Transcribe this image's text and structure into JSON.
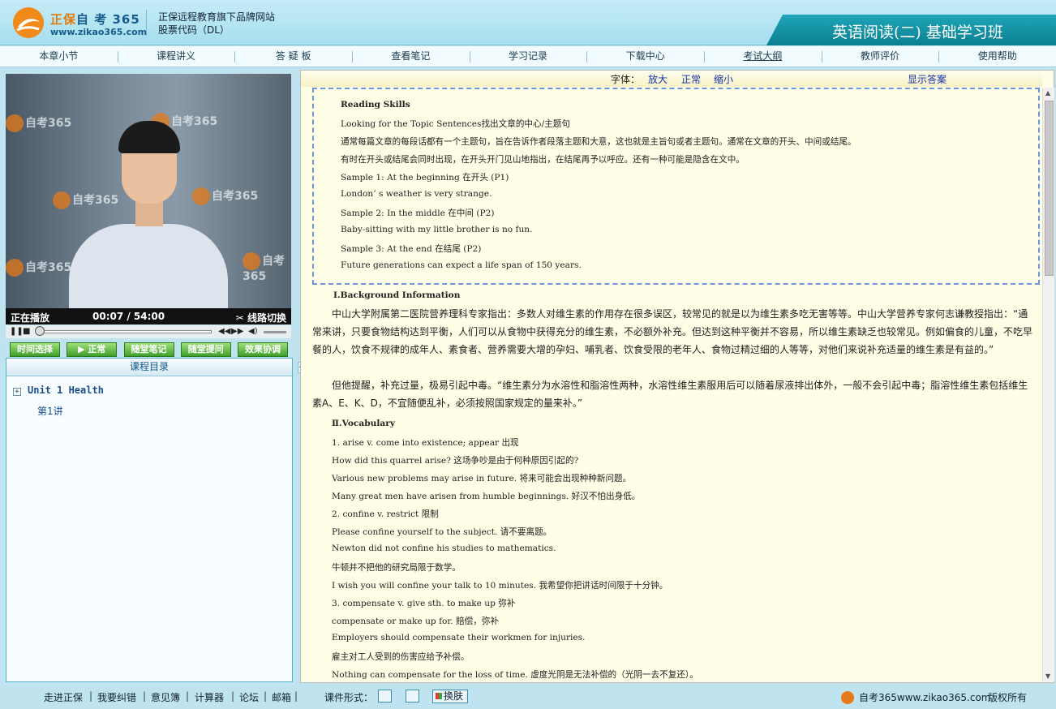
{
  "header": {
    "brand_cn": "正保",
    "brand_cn2": "自 考 365",
    "brand_url": "www.zikao365.com",
    "tagline1": "正保远程教育旗下品牌网站",
    "tagline2": "股票代码（DL）",
    "course_title": "英语阅读(二) 基础学习班"
  },
  "nav": [
    "本章小节",
    "课程讲义",
    "答 疑 板",
    "查看笔记",
    "学习记录",
    "下载中心",
    "考试大纲",
    "教师评价",
    "使用帮助"
  ],
  "player": {
    "watermark": "自考365",
    "status": "正在播放",
    "time": "00:07 / 54:00",
    "line_switch": "线路切换",
    "buttons": [
      "时间选择",
      "▶ 正常",
      "随堂笔记",
      "随堂提问",
      "效果协调"
    ]
  },
  "catalog": {
    "title": "课程目录",
    "unit": "Unit 1  Health",
    "lesson": "第1讲"
  },
  "fontbar": {
    "label": "字体：",
    "larger": "放大",
    "normal": "正常",
    "smaller": "缩小",
    "show_answer": "显示答案"
  },
  "reading_box": [
    "Reading Skills",
    "Looking for the Topic Sentences找出文章的中心/主题句",
    "通常每篇文章的每段话都有一个主题句，旨在告诉作者段落主题和大意，这也就是主旨句或者主题句。通常在文章的开头、中间或结尾。",
    "有时在开头或结尾会同时出现，在开头开门见山地指出，在结尾再予以呼应。还有一种可能是隐含在文中。",
    "Sample 1: At the beginning 在开头 (P1)",
    "London’ s weather is very strange.",
    "Sample 2: In the middle 在中间 (P2)",
    "Baby-sitting with my little brother is no fun.",
    "Sample 3: At the end 在结尾 (P2)",
    "Future generations can expect a life span of 150 years."
  ],
  "background": {
    "heading": "Ⅰ.Background Information",
    "para1": "中山大学附属第二医院营养理科专家指出：多数人对维生素的作用存在很多误区，较常见的就是以为维生素多吃无害等等。中山大学营养专家何志谦教授指出：“通常来讲，只要食物结构达到平衡，人们可以从食物中获得充分的维生素，不必额外补充。但达到这种平衡并不容易，所以维生素缺乏也较常见。例如偏食的儿童，不吃早餐的人，饮食不规律的成年人、素食者、营养需要大增的孕妇、哺乳者、饮食受限的老年人、食物过精过细的人等等，对他们来说补充适量的维生素是有益的。”",
    "para2": "但他提醒，补充过量，极易引起中毒。“维生素分为水溶性和脂溶性两种，水溶性维生素服用后可以随着尿液排出体外，一般不会引起中毒；脂溶性维生素包括维生素A、E、K、D，不宜随便乱补，必须按照国家规定的量来补。”"
  },
  "vocabulary": {
    "heading": "Ⅱ.Vocabulary",
    "lines": [
      "1. arise v. come into existence; appear 出现",
      "How did this quarrel arise? 这场争吵是由于何种原因引起的?",
      "Various new problems may arise in future. 将来可能会出现种种新问题。",
      "Many great men have arisen from humble beginnings. 好汉不怕出身低。",
      "2. confine v. restrict 限制",
      "Please confine yourself to the subject. 请不要离题。",
      "Newton did not confine his studies to mathematics.",
      "牛顿并不把他的研究局限于数学。",
      "I wish you will confine your talk to 10 minutes. 我希望你把讲话时间限于十分钟。",
      "3. compensate v. give sth. to make up 弥补",
      "compensate or make up for. 赔偿，弥补",
      "Employers should compensate their workmen for injuries.",
      "雇主对工人受到的伤害应给予补偿。",
      "Nothing can compensate for the loss of time. 虚度光阴是无法补偿的（光阴一去不复还）。"
    ]
  },
  "footer": {
    "links": [
      "走进正保",
      "我要纠错",
      "意见簿",
      "计算器",
      "论坛",
      "邮箱"
    ],
    "course_format": "课件形式：",
    "skin": "换肤",
    "site": "自考365www.zikao365.com",
    "copyright": "版权所有"
  }
}
